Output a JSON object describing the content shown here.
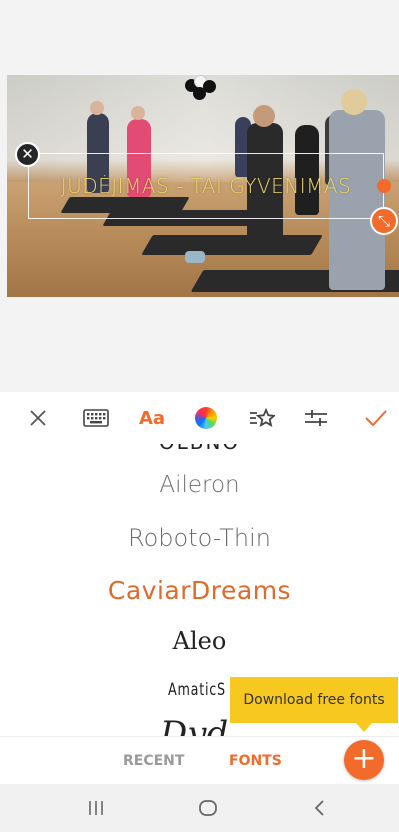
{
  "canvas": {
    "overlay_text": "JUDĖJIMAS - TAI GYVENIMAS",
    "close_icon": "close-icon",
    "resize_icon": "resize-diagonal-icon",
    "overlay_text_color": "#f0d66a"
  },
  "toolbar": {
    "icons": [
      "close-icon",
      "keyboard-icon",
      "font-icon",
      "color-wheel-icon",
      "text-effects-icon",
      "adjust-sliders-icon",
      "check-icon"
    ],
    "font_label": "Aa",
    "accent": "#f26b2a"
  },
  "fonts": {
    "items": [
      "Aileron",
      "Roboto-Thin",
      "CaviarDreams",
      "Aleo",
      "AmaticS"
    ],
    "selected": "CaviarDreams",
    "cut_top": "OLBNO",
    "cut_bottom": "Dyd"
  },
  "tooltip": {
    "text": "Download free fonts",
    "color": "#f7c820"
  },
  "tabs": {
    "recent": "RECENT",
    "fonts": "FONTS",
    "active": "FONTS"
  },
  "fab": {
    "label": "+"
  },
  "system_nav": {
    "icons": [
      "recents-icon",
      "home-icon",
      "back-icon"
    ]
  }
}
